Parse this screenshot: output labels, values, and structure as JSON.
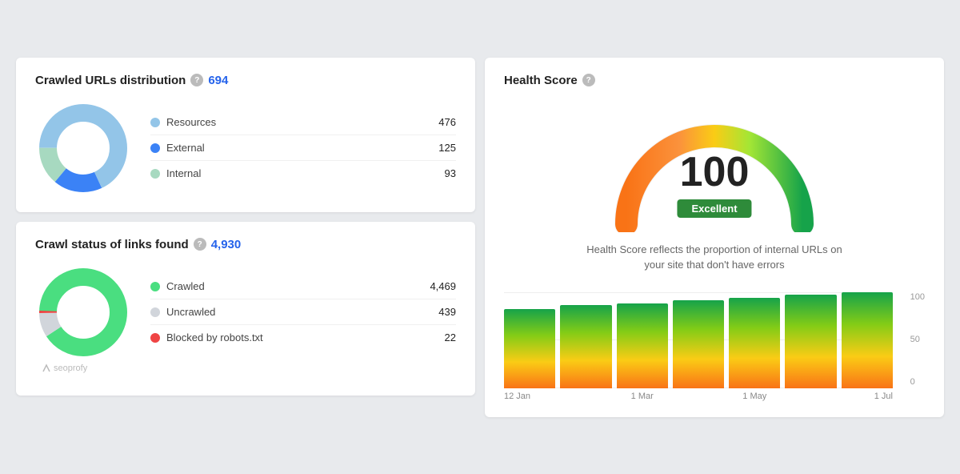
{
  "crawled_urls": {
    "title": "Crawled URLs distribution",
    "total": "694",
    "items": [
      {
        "label": "Resources",
        "value": "476",
        "color": "#93c5e8"
      },
      {
        "label": "External",
        "value": "125",
        "color": "#3b82f6"
      },
      {
        "label": "Internal",
        "value": "93",
        "color": "#a7d9c0"
      }
    ],
    "donut": {
      "resources_pct": 68,
      "external_pct": 18,
      "internal_pct": 14
    }
  },
  "crawl_status": {
    "title": "Crawl status of links found",
    "total": "4,930",
    "items": [
      {
        "label": "Crawled",
        "value": "4,469",
        "color": "#4ade80"
      },
      {
        "label": "Uncrawled",
        "value": "439",
        "color": "#d1d5db"
      },
      {
        "label": "Blocked by robots.txt",
        "value": "22",
        "color": "#ef4444"
      }
    ]
  },
  "health_score": {
    "title": "Health Score",
    "score": "100",
    "badge": "Excellent",
    "description": "Health Score reflects the proportion of internal URLs on your site that don't have errors",
    "chart": {
      "x_labels": [
        "12 Jan",
        "1 Mar",
        "1 May",
        "1 Jul"
      ],
      "bars": [
        85,
        88,
        90,
        92,
        95,
        97,
        100
      ],
      "y_labels": [
        "100",
        "50",
        "0"
      ]
    }
  },
  "watermark": "seoprofy"
}
